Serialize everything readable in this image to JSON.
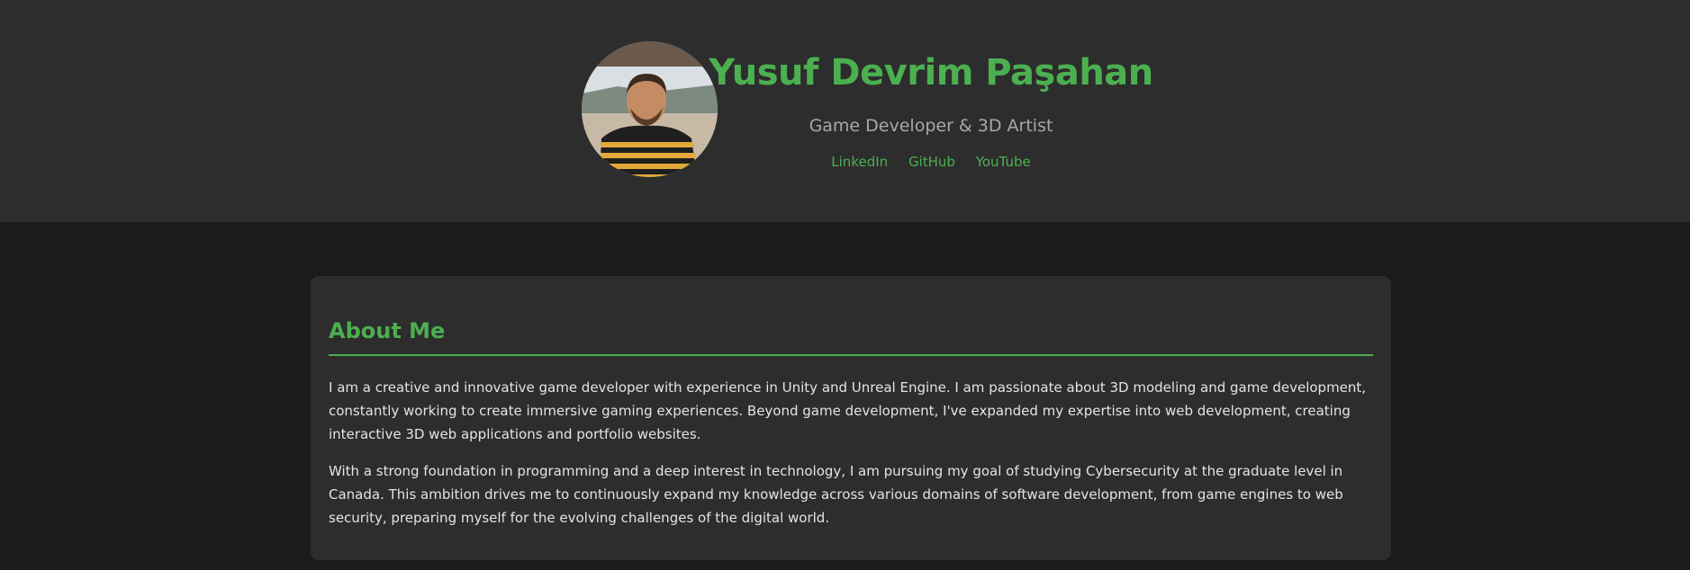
{
  "header": {
    "name": "Yusuf Devrim Paşahan",
    "tagline": "Game Developer & 3D Artist",
    "links": [
      {
        "label": "LinkedIn"
      },
      {
        "label": "GitHub"
      },
      {
        "label": "YouTube"
      }
    ],
    "avatar_icon": "profile-photo"
  },
  "about": {
    "heading": "About Me",
    "paragraphs": [
      "I am a creative and innovative game developer with experience in Unity and Unreal Engine. I am passionate about 3D modeling and game development, constantly working to create immersive gaming experiences. Beyond game development, I've expanded my expertise into web development, creating interactive 3D web applications and portfolio websites.",
      "With a strong foundation in programming and a deep interest in technology, I am pursuing my goal of studying Cybersecurity at the graduate level in Canada. This ambition drives me to continuously expand my knowledge across various domains of software development, from game engines to web security, preparing myself for the evolving challenges of the digital world."
    ]
  },
  "colors": {
    "accent": "#4caf50",
    "header_bg": "#2d2d2d",
    "page_bg": "#1b1b1b",
    "card_bg": "#2d2d2d"
  }
}
